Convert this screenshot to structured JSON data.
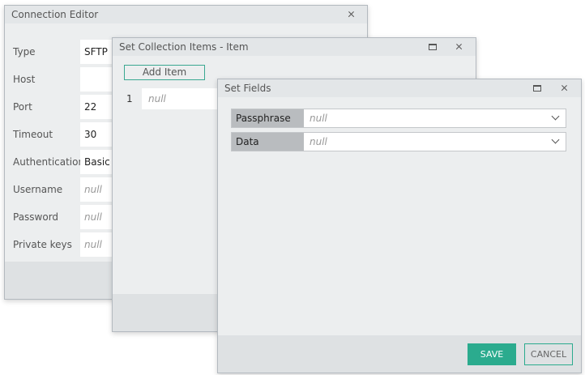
{
  "connection_editor": {
    "title": "Connection Editor",
    "fields": [
      {
        "label": "Type",
        "value": "SFTP"
      },
      {
        "label": "Host",
        "value": ""
      },
      {
        "label": "Port",
        "value": "22"
      },
      {
        "label": "Timeout",
        "value": "30"
      },
      {
        "label": "Authentication",
        "value": "Basic"
      },
      {
        "label": "Username",
        "value": "null"
      },
      {
        "label": "Password",
        "value": "null"
      },
      {
        "label": "Private keys",
        "value": "null"
      }
    ]
  },
  "collection_items": {
    "title": "Set Collection Items - Item",
    "add_item_label": "Add Item",
    "items": [
      {
        "index": "1",
        "value": "null"
      }
    ]
  },
  "set_fields": {
    "title": "Set Fields",
    "fields": [
      {
        "label": "Passphrase",
        "value": "null"
      },
      {
        "label": "Data",
        "value": "null"
      }
    ],
    "save_label": "SAVE",
    "cancel_label": "CANCEL"
  },
  "icons": [
    "close-icon",
    "maximize-icon",
    "chevron-down-icon"
  ],
  "colors": {
    "accent": "#2bab8e",
    "label_bg": "#b9bcbf",
    "panel_bg": "#eceeef"
  }
}
